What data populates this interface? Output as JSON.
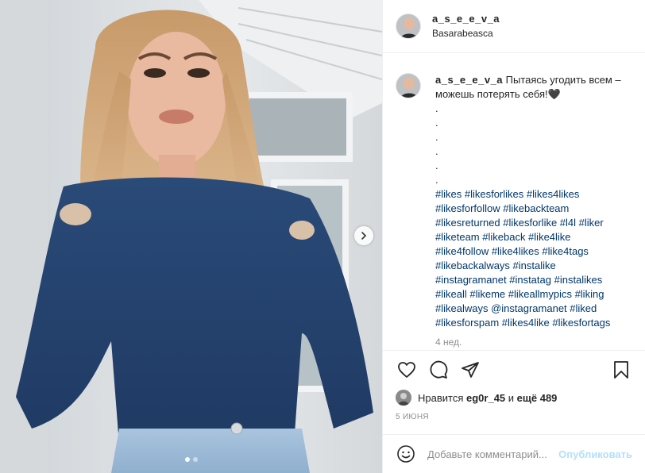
{
  "post": {
    "username": "a_s_e_e_v_a",
    "location": "Basarabeasca"
  },
  "caption": {
    "username": "a_s_e_e_v_a",
    "text_lines": [
      "Пытаясь угодить всем –",
      "можешь потерять себя!🖤",
      ".",
      ".",
      ".",
      ".",
      ".",
      "."
    ],
    "hashtag_lines": [
      "#likes #likesforlikes #likes4likes",
      "#likesforfollow #likebackteam",
      "#likesreturned #likesforlike #l4l #liker",
      "#liketeam #likeback #like4like",
      "#like4follow #like4likes #like4tags",
      "#likebackalways #instalike",
      "#instagramanet #instatag #instalikes",
      "#likeall #likeme #likeallmypics #liking",
      "#likealways @instagramanet #liked",
      "#likesforspam #likes4like #likesfortags"
    ],
    "time": "4 нед."
  },
  "likes": {
    "prefix": "Нравится",
    "user": "eg0r_45",
    "middle": "и",
    "count": "ещё 489"
  },
  "date": "5 ИЮНЯ",
  "comment": {
    "placeholder": "Добавьте комментарий...",
    "publish_label": "Опубликовать"
  },
  "icons": {
    "like": "heart-icon",
    "comment": "comment-icon",
    "share": "paper-plane-icon",
    "save": "bookmark-icon",
    "emoji": "smiley-icon",
    "next": "chevron-right-icon"
  },
  "carousel": {
    "slides": 2,
    "active": 1
  },
  "colors": {
    "link": "#00376b",
    "publish_disabled": "#b2dffc",
    "muted": "#8e8e8e",
    "border": "#efefef"
  }
}
